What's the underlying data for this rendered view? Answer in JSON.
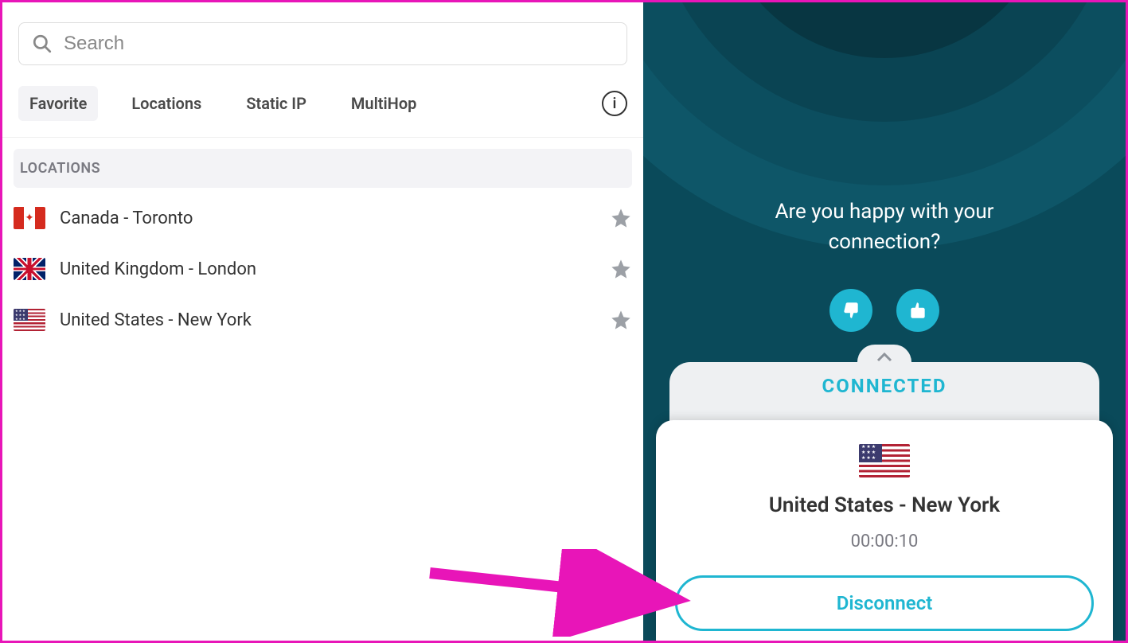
{
  "search": {
    "placeholder": "Search"
  },
  "tabs": {
    "favorite": "Favorite",
    "locations": "Locations",
    "static_ip": "Static IP",
    "multihop": "MultiHop"
  },
  "section": {
    "header": "LOCATIONS"
  },
  "locations": [
    {
      "label": "Canada - Toronto",
      "flag": "ca"
    },
    {
      "label": "United Kingdom - London",
      "flag": "uk"
    },
    {
      "label": "United States - New York",
      "flag": "us"
    }
  ],
  "feedback": {
    "line1": "Are you happy with your",
    "line2": "connection?"
  },
  "status": {
    "label": "CONNECTED"
  },
  "connection": {
    "location": "United States - New York",
    "duration": "00:00:10",
    "disconnect_label": "Disconnect"
  }
}
